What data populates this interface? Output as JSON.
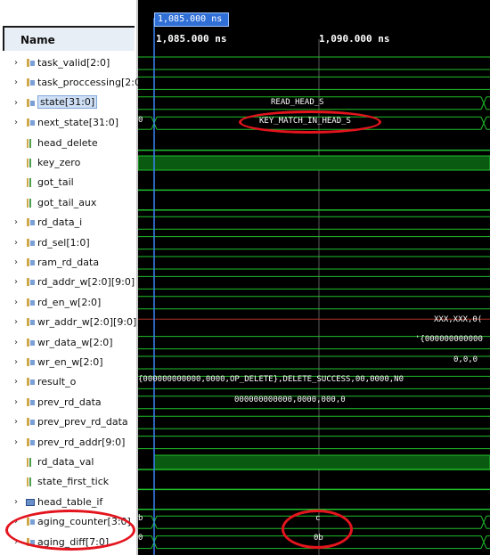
{
  "header": {
    "name_label": "Name"
  },
  "cursor": {
    "time_label": "1,085.000 ns"
  },
  "timeline": {
    "ticks": [
      "1,085.000 ns",
      "1,090.000 ns"
    ]
  },
  "signals": [
    {
      "label": "task_valid[2:0]",
      "type": "bus",
      "expandable": true
    },
    {
      "label": "task_proccessing[2:0]",
      "type": "bus",
      "expandable": true
    },
    {
      "label": "state[31:0]",
      "type": "bus",
      "expandable": true,
      "selected": true
    },
    {
      "label": "next_state[31:0]",
      "type": "bus",
      "expandable": true
    },
    {
      "label": "head_delete",
      "type": "bit",
      "expandable": false
    },
    {
      "label": "key_zero",
      "type": "bit",
      "expandable": false
    },
    {
      "label": "got_tail",
      "type": "bit",
      "expandable": false
    },
    {
      "label": "got_tail_aux",
      "type": "bit",
      "expandable": false
    },
    {
      "label": "rd_data_i",
      "type": "bus",
      "expandable": true
    },
    {
      "label": "rd_sel[1:0]",
      "type": "bus",
      "expandable": true
    },
    {
      "label": "ram_rd_data",
      "type": "bus",
      "expandable": true
    },
    {
      "label": "rd_addr_w[2:0][9:0]",
      "type": "bus",
      "expandable": true
    },
    {
      "label": "rd_en_w[2:0]",
      "type": "bus",
      "expandable": true
    },
    {
      "label": "wr_addr_w[2:0][9:0]",
      "type": "bus",
      "expandable": true
    },
    {
      "label": "wr_data_w[2:0]",
      "type": "bus",
      "expandable": true
    },
    {
      "label": "wr_en_w[2:0]",
      "type": "bus",
      "expandable": true
    },
    {
      "label": "result_o",
      "type": "bus",
      "expandable": true
    },
    {
      "label": "prev_rd_data",
      "type": "bus",
      "expandable": true
    },
    {
      "label": "prev_prev_rd_data",
      "type": "bus",
      "expandable": true
    },
    {
      "label": "prev_rd_addr[9:0]",
      "type": "bus",
      "expandable": true
    },
    {
      "label": "rd_data_val",
      "type": "bit",
      "expandable": false
    },
    {
      "label": "state_first_tick",
      "type": "bit",
      "expandable": false
    },
    {
      "label": "head_table_if",
      "type": "intf",
      "expandable": true
    },
    {
      "label": "aging_counter[3:0]",
      "type": "bus",
      "expandable": true
    },
    {
      "label": "aging_diff[7:0]",
      "type": "bus",
      "expandable": true
    }
  ],
  "values": {
    "state": "READ_HEAD_S",
    "next_state": "KEY_MATCH_IN_HEAD_S",
    "next_state_prev": "0",
    "wr_addr": "XXX,XXX,0(",
    "wr_data": "'{000000000000",
    "wr_en": "0,0,0",
    "result_o": "{000000000000,0000,OP_DELETE},DELETE_SUCCESS,00,0000,N0",
    "prev_rd_data": "000000000000,0000,000,0",
    "aging_counter": "c",
    "aging_counter_prev": "b",
    "aging_diff": "0b",
    "aging_diff_prev": "0"
  },
  "colors": {
    "wave": "#1fbf2b",
    "high_fill": "#0b5a12",
    "cursor": "#3b82f6",
    "annotation": "#e3141d"
  }
}
